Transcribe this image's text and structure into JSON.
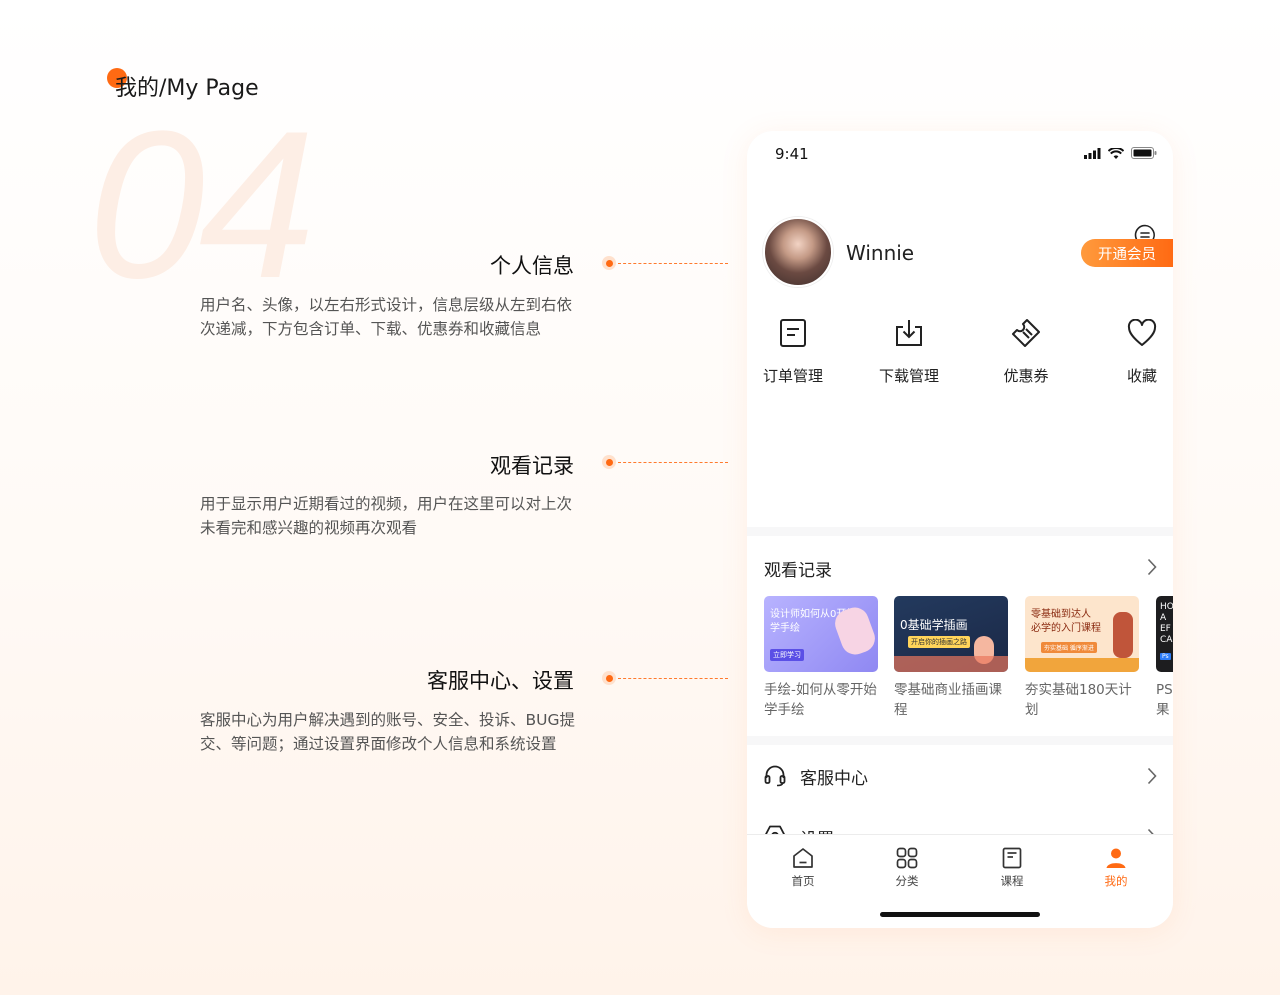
{
  "header": {
    "title": "我的/My Page",
    "number": "04"
  },
  "sections": [
    {
      "title": "个人信息",
      "desc": "用户名、头像，以左右形式设计，信息层级从左到右依次递减，下方包含订单、下载、优惠券和收藏信息"
    },
    {
      "title": "观看记录",
      "desc": "用于显示用户近期看过的视频，用户在这里可以对上次未看完和感兴趣的视频再次观看"
    },
    {
      "title": "客服中心、设置",
      "desc": "客服中心为用户解决遇到的账号、安全、投诉、BUG提交、等问题；通过设置界面修改个人信息和系统设置"
    }
  ],
  "phone": {
    "status": {
      "time": "9:41"
    },
    "profile": {
      "username": "Winnie",
      "vip_label": "开通会员"
    },
    "quick_actions": [
      {
        "label": "订单管理",
        "icon": "order-icon"
      },
      {
        "label": "下载管理",
        "icon": "download-icon"
      },
      {
        "label": "优惠券",
        "icon": "coupon-icon"
      },
      {
        "label": "收藏",
        "icon": "heart-icon"
      }
    ],
    "history": {
      "title": "观看记录",
      "courses": [
        {
          "title": "手绘-如何从零开始学手绘",
          "thumb_text": "设计师如何从0开始\n学手绘",
          "thumb_badge": "立即学习"
        },
        {
          "title": "零基础商业插画课程",
          "thumb_text": "0基础学插画",
          "thumb_badge": "开启你的插画之路"
        },
        {
          "title": "夯实基础180天计划",
          "thumb_text": "零基础到达人\n必学的入门课程",
          "thumb_badge": "夯实基础 循序渐进"
        },
        {
          "title": "PS果",
          "thumb_text": "HOW\nA\nEF\nCA",
          "thumb_badge": "Ps"
        }
      ]
    },
    "menu": [
      {
        "label": "客服中心",
        "icon": "headset-icon"
      },
      {
        "label": "设置",
        "icon": "settings-icon"
      }
    ],
    "tabs": [
      {
        "label": "首页",
        "icon": "home-icon",
        "active": false
      },
      {
        "label": "分类",
        "icon": "category-icon",
        "active": false
      },
      {
        "label": "课程",
        "icon": "course-icon",
        "active": false
      },
      {
        "label": "我的",
        "icon": "profile-icon",
        "active": true
      }
    ],
    "colors": {
      "accent": "#ff6a13",
      "accent_light": "#ff9a3c"
    }
  }
}
